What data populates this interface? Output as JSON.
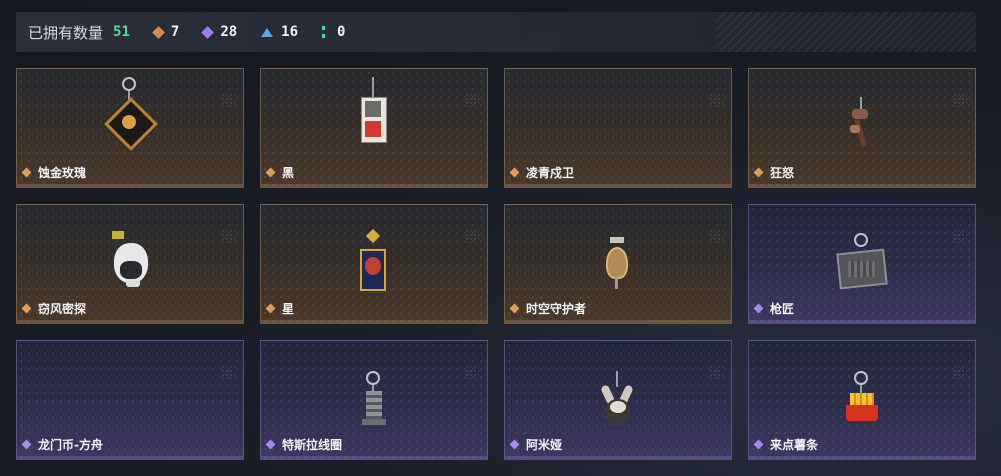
{
  "header": {
    "owned_label": "已拥有数量",
    "owned_count": "51",
    "stats": [
      {
        "icon": "orange-diamond-icon",
        "color": "#d88a4a",
        "value": "7"
      },
      {
        "icon": "purple-diamond-icon",
        "color": "#9f7ce6",
        "value": "28"
      },
      {
        "icon": "blue-triangle-icon",
        "color": "#5aa8e6",
        "value": "16"
      },
      {
        "icon": "green-dots-icon",
        "color": "#39e39b",
        "value": "0"
      }
    ]
  },
  "items": [
    {
      "name": "蚀金玫瑰",
      "rarity": "orange",
      "icon": "gold-rose-charm-icon"
    },
    {
      "name": "黑",
      "rarity": "orange",
      "icon": "card-tag-charm-icon"
    },
    {
      "name": "凌青戍卫",
      "rarity": "orange",
      "icon": "empty-slot-icon"
    },
    {
      "name": "狂怒",
      "rarity": "orange",
      "icon": "rope-charm-icon"
    },
    {
      "name": "窃风密探",
      "rarity": "orange",
      "icon": "rabbit-figure-charm-icon"
    },
    {
      "name": "星",
      "rarity": "orange",
      "icon": "tarot-card-charm-icon"
    },
    {
      "name": "时空守护者",
      "rarity": "orange",
      "icon": "golden-ornament-charm-icon"
    },
    {
      "name": "枪匠",
      "rarity": "purple",
      "icon": "armor-box-charm-icon"
    },
    {
      "name": "龙门币-方舟",
      "rarity": "purple",
      "icon": "empty-slot-icon"
    },
    {
      "name": "特斯拉线圈",
      "rarity": "purple",
      "icon": "tesla-coil-charm-icon"
    },
    {
      "name": "阿米娅",
      "rarity": "purple",
      "icon": "amiya-figure-charm-icon"
    },
    {
      "name": "来点薯条",
      "rarity": "purple",
      "icon": "fries-charm-icon"
    }
  ]
}
